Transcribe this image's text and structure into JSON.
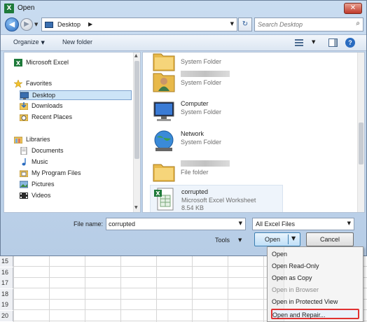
{
  "window": {
    "app_icon": "X",
    "title": "Open",
    "close_glyph": "✕"
  },
  "address": {
    "location": "Desktop",
    "breadcrumb_arrow": "▶",
    "search_placeholder": "Search Desktop"
  },
  "toolbar": {
    "organize_label": "Organize",
    "new_folder_label": "New folder",
    "help_glyph": "?"
  },
  "sidebar": {
    "items": [
      {
        "label": "Microsoft Excel",
        "icon": "excel-icon",
        "indent": false,
        "selected": false
      },
      {
        "label": "Favorites",
        "icon": "star-icon",
        "indent": false,
        "selected": false
      },
      {
        "label": "Desktop",
        "icon": "desktop-icon",
        "indent": true,
        "selected": true
      },
      {
        "label": "Downloads",
        "icon": "downloads-icon",
        "indent": true,
        "selected": false
      },
      {
        "label": "Recent Places",
        "icon": "recent-places-icon",
        "indent": true,
        "selected": false
      },
      {
        "label": "Libraries",
        "icon": "libraries-icon",
        "indent": false,
        "selected": false
      },
      {
        "label": "Documents",
        "icon": "documents-icon",
        "indent": true,
        "selected": false
      },
      {
        "label": "Music",
        "icon": "music-icon",
        "indent": true,
        "selected": false
      },
      {
        "label": "My Program Files",
        "icon": "program-files-icon",
        "indent": true,
        "selected": false
      },
      {
        "label": "Pictures",
        "icon": "pictures-icon",
        "indent": true,
        "selected": false
      },
      {
        "label": "Videos",
        "icon": "videos-icon",
        "indent": true,
        "selected": false
      }
    ]
  },
  "files": {
    "items": [
      {
        "name": "",
        "desc": "System Folder",
        "size": "",
        "icon": "folder-icon",
        "blurred": false
      },
      {
        "name": "",
        "desc": "System Folder",
        "size": "",
        "icon": "user-folder-icon",
        "blurred": true
      },
      {
        "name": "Computer",
        "desc": "System Folder",
        "size": "",
        "icon": "computer-icon",
        "blurred": false
      },
      {
        "name": "Network",
        "desc": "System Folder",
        "size": "",
        "icon": "network-icon",
        "blurred": false
      },
      {
        "name": "",
        "desc": "File folder",
        "size": "",
        "icon": "folder-icon",
        "blurred": true
      },
      {
        "name": "corrupted",
        "desc": "Microsoft Excel Worksheet",
        "size": "8.54 KB",
        "icon": "excel-file-icon",
        "blurred": false
      }
    ]
  },
  "bottom": {
    "file_name_label": "File name:",
    "file_name_value": "corrupted",
    "filter_value": "All Excel Files",
    "tools_label": "Tools",
    "open_label": "Open",
    "cancel_label": "Cancel"
  },
  "open_menu": {
    "items": [
      {
        "label": "Open",
        "enabled": true,
        "highlighted": false
      },
      {
        "label": "Open Read-Only",
        "enabled": true,
        "highlighted": false
      },
      {
        "label": "Open as Copy",
        "enabled": true,
        "highlighted": false
      },
      {
        "label": "Open in Browser",
        "enabled": false,
        "highlighted": false
      },
      {
        "label": "Open in Protected View",
        "enabled": true,
        "highlighted": false
      },
      {
        "label": "Open and Repair...",
        "enabled": true,
        "highlighted": true
      }
    ]
  },
  "sheet": {
    "rows": [
      "15",
      "16",
      "17",
      "18",
      "19",
      "20"
    ]
  },
  "colors": {
    "highlight_border": "#e03131",
    "selection": "#cce4f7",
    "excel_green": "#1e7a3a"
  }
}
